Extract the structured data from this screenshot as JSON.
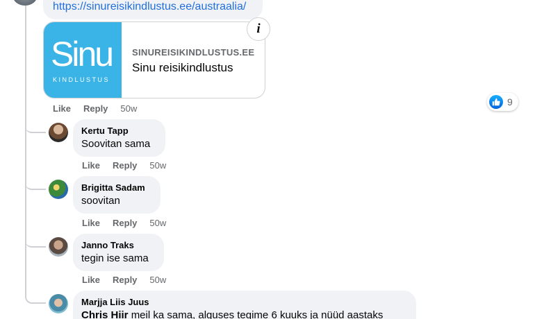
{
  "link_comment": {
    "url": "https://sinureisikindlustus.ee/austraalia/",
    "preview": {
      "logo_word": "Sinu",
      "logo_sub": "KINDLUSTUS",
      "domain": "SINUREISIKINDLUSTUS.EE",
      "title": "Sinu reisikindlustus",
      "info_glyph": "i"
    },
    "actions": {
      "like": "Like",
      "reply": "Reply",
      "time": "50w"
    },
    "reaction": {
      "icon": "thumbs-up-icon",
      "count": "9"
    }
  },
  "replies": [
    {
      "name": "Kertu Tapp",
      "text": "Soovitan sama",
      "like": "Like",
      "reply": "Reply",
      "time": "50w"
    },
    {
      "name": "Brigitta Sadam",
      "text": "soovitan",
      "like": "Like",
      "reply": "Reply",
      "time": "50w"
    },
    {
      "name": "Janno Traks",
      "text": "tegin ise sama",
      "like": "Like",
      "reply": "Reply",
      "time": "50w"
    },
    {
      "name": "Marjja Liis Juus",
      "mention": "Chris Hiir",
      "text": "meil ka sama, alguses tegime 6 kuuks ja nüüd aastaks"
    }
  ],
  "colors": {
    "link": "#216fdb",
    "bubble": "#f0f2f5",
    "muted": "#65676b",
    "brand": "#3ab3e6"
  }
}
